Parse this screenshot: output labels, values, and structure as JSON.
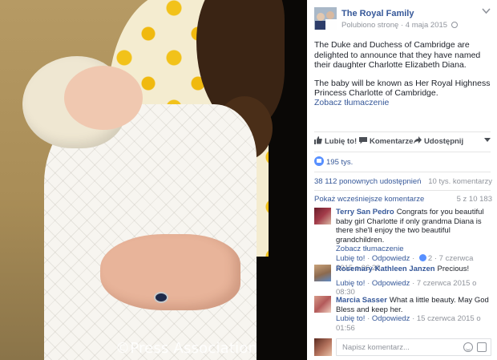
{
  "photo": {
    "watermark": "©Press Association"
  },
  "post": {
    "page_name": "The Royal Family",
    "liked_label": "Polubiono stronę",
    "date": "4 maja 2015",
    "separator": "·",
    "text_paragraph_1": "The Duke and Duchess of Cambridge are delighted to announce that they have named their daughter Charlotte Elizabeth Diana.",
    "text_paragraph_2": "The baby will be known as Her Royal Highness Princess Charlotte of Cambridge.",
    "translate_label": "Zobacz tłumaczenie"
  },
  "actions": {
    "like": "Lubię to!",
    "comment": "Komentarze",
    "share": "Udostępnij"
  },
  "stats": {
    "reactions": "195 tys.",
    "shares": "38 112 ponownych udostępnień",
    "comments": "10 tys. komentarzy",
    "previous_comments": "Pokaż wcześniejsze komentarze",
    "comments_shown": "5 z 10 183"
  },
  "comments": [
    {
      "author": "Terry San Pedro",
      "text": "Congrats for you beautiful baby girl Charlotte if only grandma Diana is there she'll enjoy the two beautiful grandchildren.",
      "translate": "Zobacz tłumaczenie",
      "like": "Lubię to!",
      "reply": "Odpowiedz",
      "reaction_count": "2",
      "timestamp": "7 czerwca 2015 o 06:20"
    },
    {
      "author": "Rosemary Kathleen Janzen",
      "text": "Precious!",
      "like": "Lubię to!",
      "reply": "Odpowiedz",
      "timestamp": "7 czerwca 2015 o 08:30"
    },
    {
      "author": "Marcia Sasser",
      "text": "What a little beauty. May God Bless and keep her.",
      "like": "Lubię to!",
      "reply": "Odpowiedz",
      "timestamp": "15 czerwca 2015 o 01:56"
    }
  ],
  "composer": {
    "placeholder": "Napisz komentarz..."
  },
  "colors": {
    "link": "#365899",
    "meta": "#90949c",
    "text": "#1d2129",
    "like_blue": "#5890ff"
  }
}
